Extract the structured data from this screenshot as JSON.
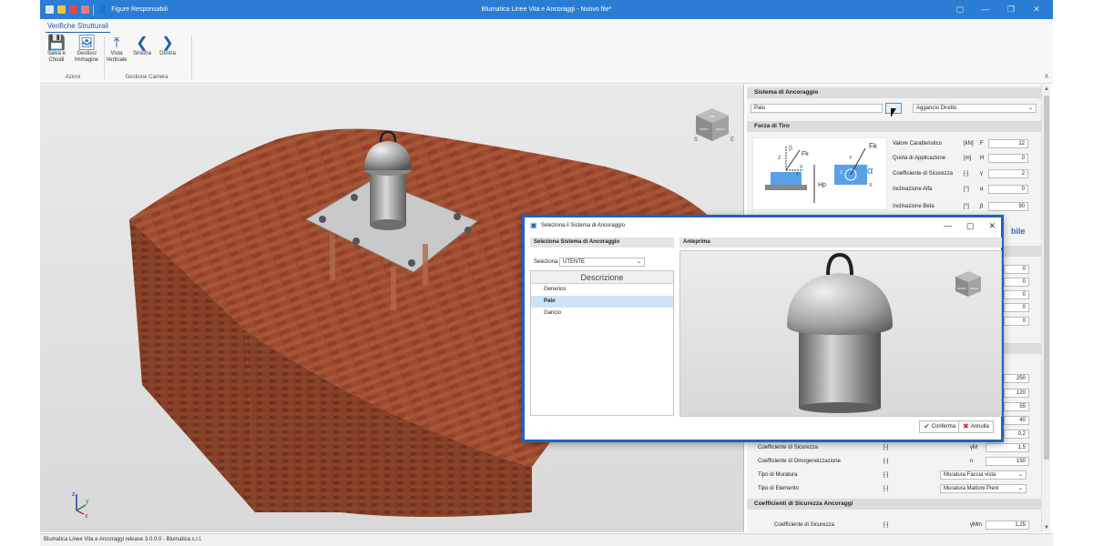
{
  "titlebar": {
    "user_label": "Figure Responsabili",
    "title": "Blumatica Linee Vita e Ancoraggi - Nuovo file*"
  },
  "ribbon": {
    "tab": "Verifiche Strutturali",
    "groups": [
      {
        "label": "Azioni",
        "buttons": [
          "Salva e Chiudi",
          "Gestisci Immagine"
        ]
      },
      {
        "label": "Gestione Camera",
        "buttons": [
          "Vista Verticale",
          "Sinistra",
          "Destra"
        ]
      }
    ]
  },
  "panel": {
    "sistema_header": "Sistema di Ancoraggio",
    "sistema_value": "Palo",
    "aggancio_value": "Aggancio Diretto",
    "forza_header": "Forza di Tiro",
    "forza_rows": [
      {
        "label": "Valore Caratteristico",
        "unit": "[kN]",
        "sym": "F",
        "value": "12"
      },
      {
        "label": "Quota di Applicazione",
        "unit": "[m]",
        "sym": "H",
        "value": "0"
      },
      {
        "label": "Coefficiente di Sicurezza",
        "unit": "[-]",
        "sym": "γ",
        "value": "2"
      },
      {
        "label": "Inclinazione Alfa",
        "unit": "[°]",
        "sym": "α",
        "value": "0"
      },
      {
        "label": "Inclinazione Beta",
        "unit": "[°]",
        "sym": "β",
        "value": "90"
      }
    ],
    "partial_right_label": "bile",
    "hidden_values_a": [
      "0",
      "0",
      "0",
      "0",
      "0"
    ],
    "hidden_values_b": [
      "250",
      "120",
      "55",
      "40",
      "0,2"
    ],
    "lower_rows": [
      {
        "label": "Coefficiente di Sicurezza",
        "unit": "[-]",
        "sym": "γM",
        "value": "1,5"
      },
      {
        "label": "Coefficiente di Omogeneizzazione",
        "unit": "[-]",
        "sym": "n",
        "value": "150"
      }
    ],
    "select_rows": [
      {
        "label": "Tipo di Muratura",
        "unit": "[-]",
        "value": "Muratura Faccia vista"
      },
      {
        "label": "Tipo di Elemento",
        "unit": "[-]",
        "value": "Muratura Mattoni Pieni"
      }
    ],
    "coeff_header": "Coefficienti di Sicurezza Ancoraggi",
    "coeff_row": {
      "label": "Coefficiente di Sicurezza",
      "unit": "[-]",
      "sym": "γMm",
      "value": "1,25"
    }
  },
  "diagram": {
    "labels": [
      "β",
      "Fk",
      "Z",
      "X",
      "Y",
      "Hp",
      "Fk",
      "α",
      "Z",
      "X",
      "Y"
    ]
  },
  "dialog": {
    "title": "Seleziona il Sistema di Ancoraggio",
    "left_header": "Seleziona Sistema di Ancoraggio",
    "select_label": "Seleziona",
    "select_value": "UTENTE",
    "list_header": "Descrizione",
    "items": [
      "Generico",
      "Palo",
      "Gancio"
    ],
    "selected_index": 1,
    "preview_header": "Anteprima",
    "confirm": "Conferma",
    "cancel": "Annulla"
  },
  "viewcube": {
    "faces": [
      "TOP",
      "FRONT",
      "RIGHT"
    ],
    "compass": [
      "S",
      "E"
    ]
  },
  "preview_cube": {
    "faces": [
      "FRONT",
      "RIGHT"
    ]
  },
  "axes": {
    "labels": [
      "z",
      "y",
      "x"
    ]
  },
  "statusbar": "Blumatica Linee Vita e Ancoraggi release 3.0.0.0 - Blumatica s.r.l.",
  "colors": {
    "accent": "#2b7cd3",
    "dialog_border": "#1f62c8",
    "brick": "#9c4a2e"
  }
}
